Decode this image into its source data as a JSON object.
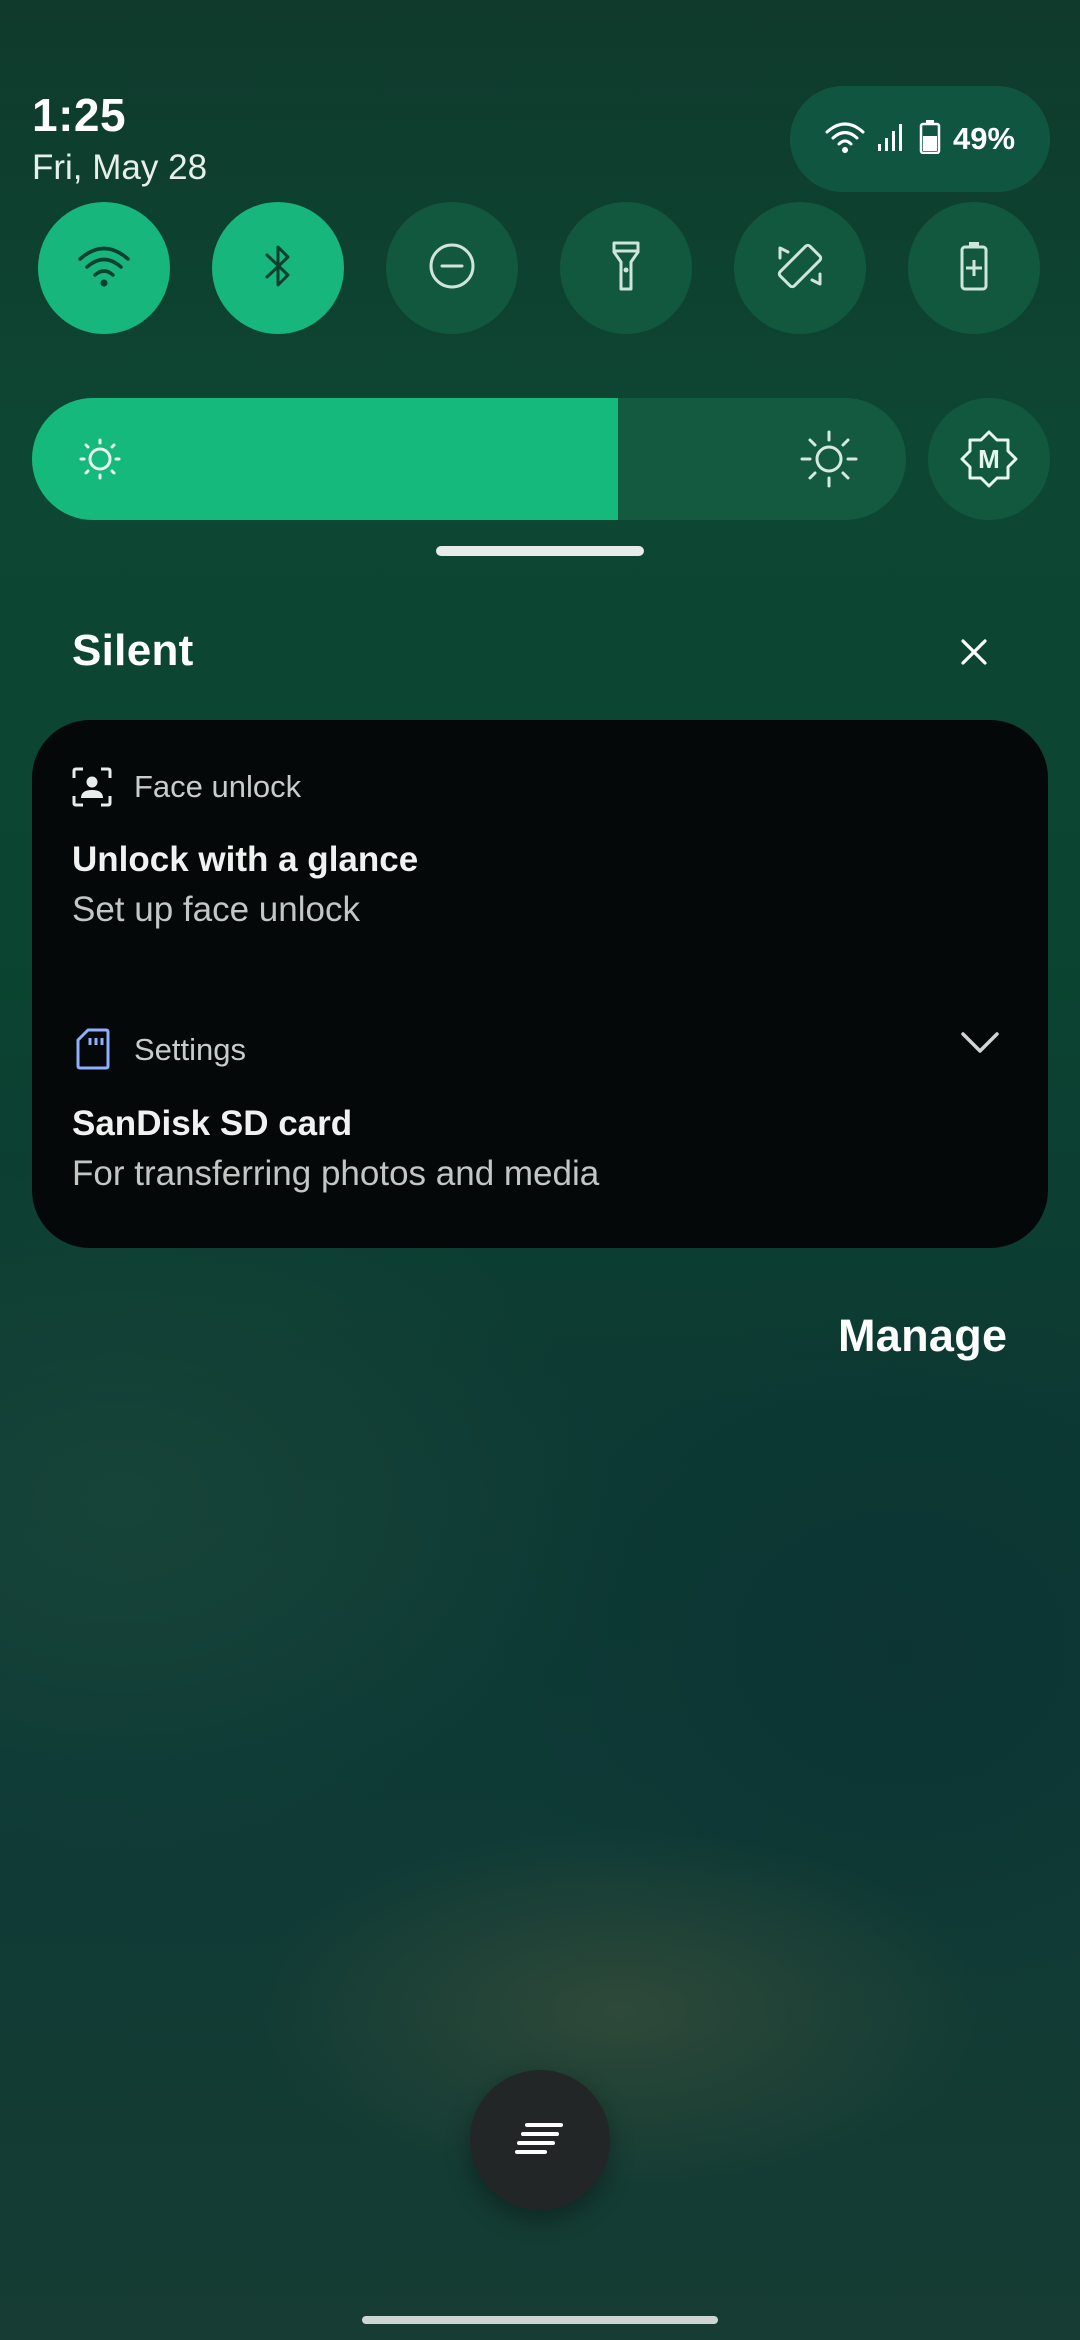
{
  "status": {
    "time": "1:25",
    "date": "Fri, May 28",
    "battery_percent": "49%"
  },
  "quick_settings": {
    "tiles": [
      {
        "name": "wifi",
        "icon": "wifi-icon",
        "active": true
      },
      {
        "name": "bluetooth",
        "icon": "bluetooth-icon",
        "active": true
      },
      {
        "name": "do-not-disturb",
        "icon": "do-not-disturb-icon",
        "active": false
      },
      {
        "name": "flashlight",
        "icon": "flashlight-icon",
        "active": false
      },
      {
        "name": "auto-rotate",
        "icon": "auto-rotate-icon",
        "active": false
      },
      {
        "name": "battery-saver",
        "icon": "battery-saver-icon",
        "active": false
      }
    ],
    "brightness_level": 0.67,
    "auto_brightness_label": "M"
  },
  "notifications": {
    "section_title": "Silent",
    "items": [
      {
        "app": "Face unlock",
        "icon": "face-unlock-icon",
        "title": "Unlock with a glance",
        "text": "Set up face unlock"
      },
      {
        "app": "Settings",
        "icon": "sd-card-icon",
        "title": "SanDisk SD card",
        "text": "For transferring photos and media"
      }
    ],
    "manage_label": "Manage"
  },
  "colors": {
    "tile_active": "#17b67c",
    "tile_inactive": "#12583f",
    "card_background": "#050808",
    "sd_icon_accent": "#8fb0ff"
  }
}
